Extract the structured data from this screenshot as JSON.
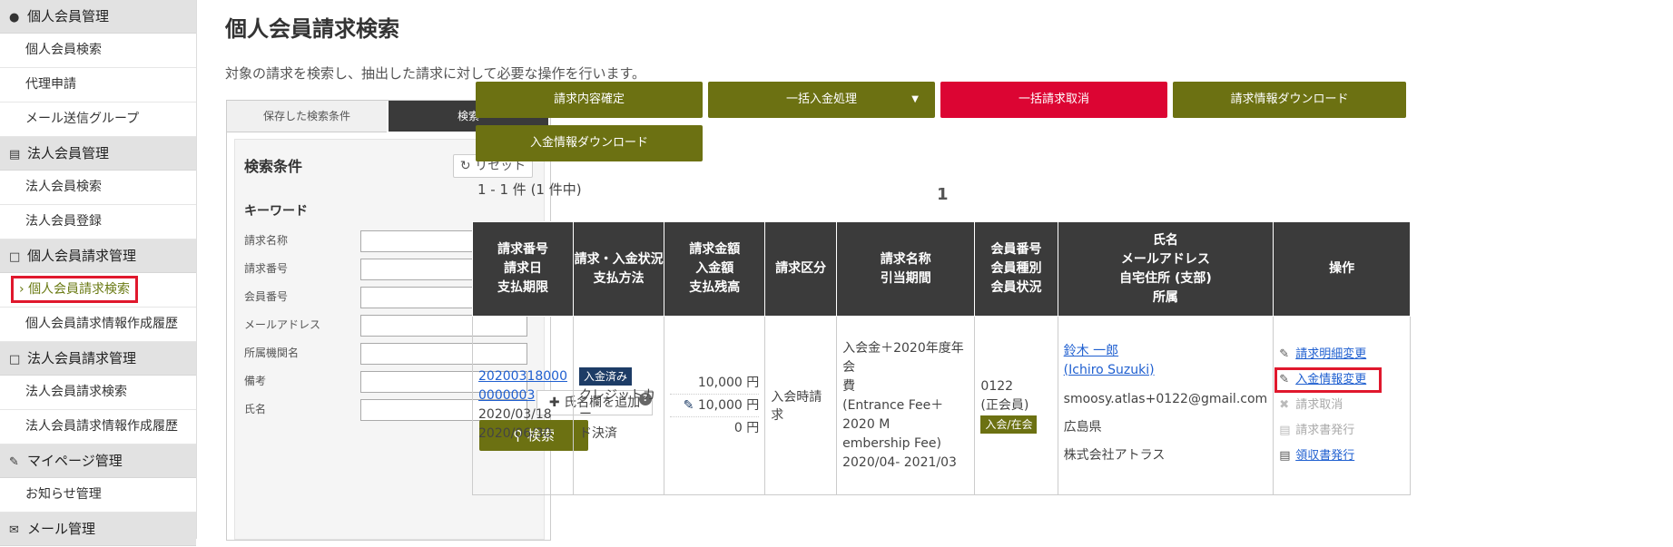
{
  "sidebar": {
    "sections": [
      {
        "title": "個人会員管理",
        "icon": "person-icon",
        "items": [
          "個人会員検索",
          "代理申請",
          "メール送信グループ"
        ]
      },
      {
        "title": "法人会員管理",
        "icon": "building-icon",
        "items": [
          "法人会員検索",
          "法人会員登録"
        ]
      },
      {
        "title": "個人会員請求管理",
        "icon": "document-icon",
        "items": [
          "個人会員請求検索",
          "個人会員請求情報作成履歴"
        ]
      },
      {
        "title": "法人会員請求管理",
        "icon": "document-icon",
        "items": [
          "法人会員請求検索",
          "法人会員請求情報作成履歴"
        ]
      },
      {
        "title": "マイページ管理",
        "icon": "pen-icon",
        "items": [
          "お知らせ管理"
        ]
      },
      {
        "title": "メール管理",
        "icon": "mail-icon",
        "items": []
      }
    ],
    "active_item": "個人会員請求検索"
  },
  "page": {
    "title": "個人会員請求検索",
    "description": "対象の請求を検索し、抽出した請求に対して必要な操作を行います。"
  },
  "search": {
    "tab_saved": "保存した検索条件",
    "tab_search": "検索",
    "conditions_title": "検索条件",
    "reset_label": "リセット",
    "keyword_label": "キーワード",
    "fields": [
      {
        "label": "請求名称",
        "value": ""
      },
      {
        "label": "請求番号",
        "value": ""
      },
      {
        "label": "会員番号",
        "value": ""
      },
      {
        "label": "メールアドレス",
        "value": ""
      },
      {
        "label": "所属機関名",
        "value": ""
      },
      {
        "label": "備考",
        "value": ""
      },
      {
        "label": "氏名",
        "value": ""
      }
    ],
    "add_name_label": "氏名欄を追加",
    "submit_label": "検索"
  },
  "actions": {
    "confirm": "請求内容確定",
    "bulk_payment": "一括入金処理",
    "bulk_cancel": "一括請求取消",
    "download_billing": "請求情報ダウンロード",
    "download_payment": "入金情報ダウンロード"
  },
  "results": {
    "count_text": "1 - 1 件 (1 件中)",
    "page": "1",
    "headers": [
      [
        "請求番号",
        "請求日",
        "支払期限"
      ],
      [
        "請求・入金状況",
        "支払方法"
      ],
      [
        "請求金額",
        "入金額",
        "支払残高"
      ],
      [
        "請求区分"
      ],
      [
        "請求名称",
        "引当期間"
      ],
      [
        "会員番号",
        "会員種別",
        "会員状況"
      ],
      [
        "氏名",
        "メールアドレス",
        "自宅住所 (支部)",
        "所属"
      ],
      [
        "操作"
      ]
    ],
    "row": {
      "billing_no_1": "20200318000",
      "billing_no_2": "0000003",
      "billing_date": "2020/03/18",
      "due_date": "2020/06/30",
      "status_badge": "入金済み",
      "payment_method_1": "クレジットカー",
      "payment_method_2": "ド決済",
      "amount_billed": "10,000 円",
      "amount_paid": "10,000 円",
      "balance": "0 円",
      "category": "入会時請求",
      "name_1": "入会金＋2020年度年会",
      "name_2": "費",
      "name_3": "(Entrance Fee＋2020 M",
      "name_4": "embership Fee)",
      "period": "2020/04- 2021/03",
      "member_no": "0122",
      "member_type": "(正会員)",
      "member_status": "入会/在会",
      "person_name": "鈴木 一郎",
      "person_name_en": "(Ichiro Suzuki)",
      "email": "smoosy.atlas+0122@gmail.com",
      "address": "広島県",
      "affiliation": "株式会社アトラス",
      "ops": {
        "edit_detail": "請求明細変更",
        "edit_payment": "入金情報変更",
        "cancel": "請求取消",
        "issue_invoice": "請求書発行",
        "issue_receipt": "領収書発行"
      }
    }
  },
  "colors": {
    "olive": "#6c7112",
    "red": "#dc0533",
    "navy": "#1d3c66",
    "dark_header": "#3b3b3b",
    "highlight_red": "#e0182d"
  }
}
